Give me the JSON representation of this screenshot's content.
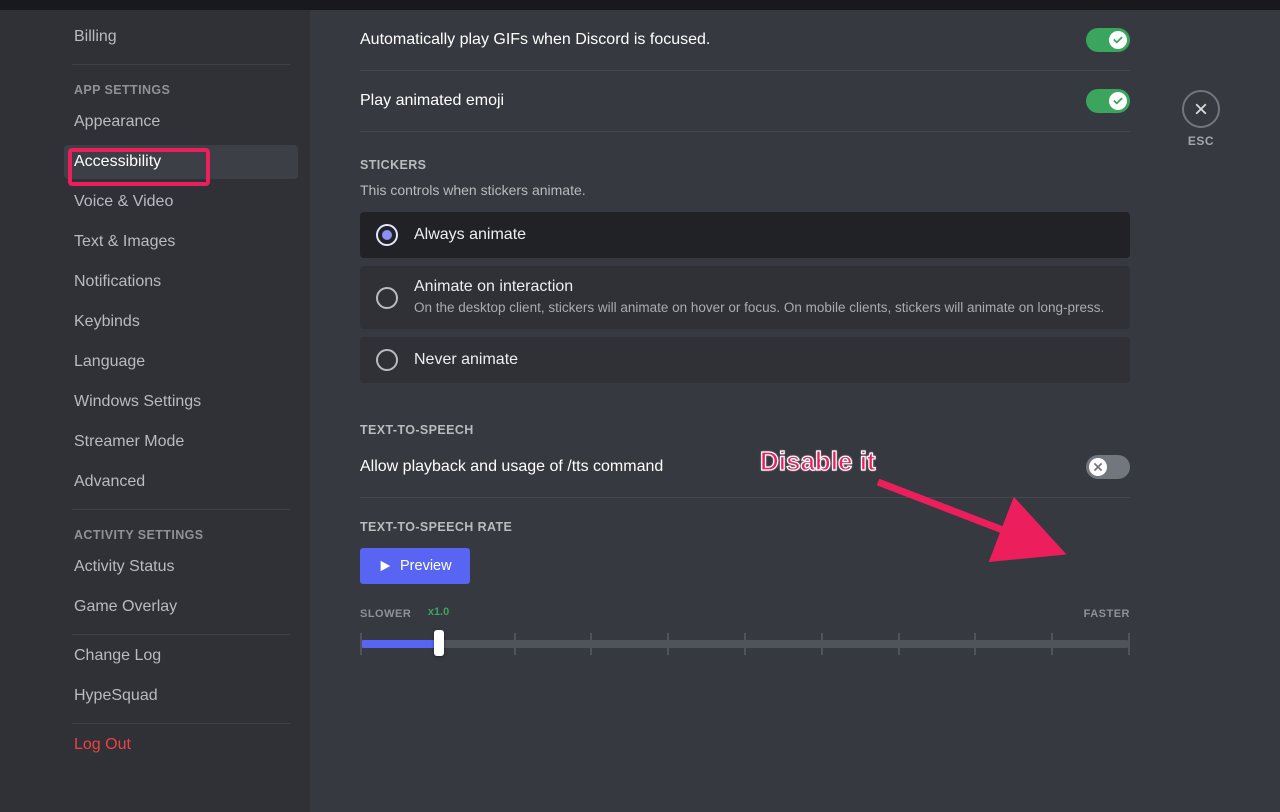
{
  "sidebar": {
    "billing": "Billing",
    "header_app": "APP SETTINGS",
    "appearance": "Appearance",
    "accessibility": "Accessibility",
    "voice": "Voice & Video",
    "text": "Text & Images",
    "notifications": "Notifications",
    "keybinds": "Keybinds",
    "language": "Language",
    "windows": "Windows Settings",
    "streamer": "Streamer Mode",
    "advanced": "Advanced",
    "header_activity": "ACTIVITY SETTINGS",
    "activity_status": "Activity Status",
    "overlay": "Game Overlay",
    "changelog": "Change Log",
    "hypesquad": "HypeSquad",
    "logout": "Log Out"
  },
  "settings": {
    "gifs_label": "Automatically play GIFs when Discord is focused.",
    "emoji_label": "Play animated emoji",
    "stickers_title": "STICKERS",
    "stickers_desc": "This controls when stickers animate.",
    "radio_always": "Always animate",
    "radio_interaction_title": "Animate on interaction",
    "radio_interaction_sub": "On the desktop client, stickers will animate on hover or focus. On mobile clients, stickers will animate on long-press.",
    "radio_never": "Never animate",
    "tts_title": "TEXT-TO-SPEECH",
    "tts_label": "Allow playback and usage of /tts command",
    "rate_title": "TEXT-TO-SPEECH RATE",
    "preview": "Preview",
    "slower": "SLOWER",
    "faster": "FASTER",
    "rate_value": "x1.0"
  },
  "close": {
    "esc": "ESC"
  },
  "annotation": {
    "text": "Disable it"
  }
}
